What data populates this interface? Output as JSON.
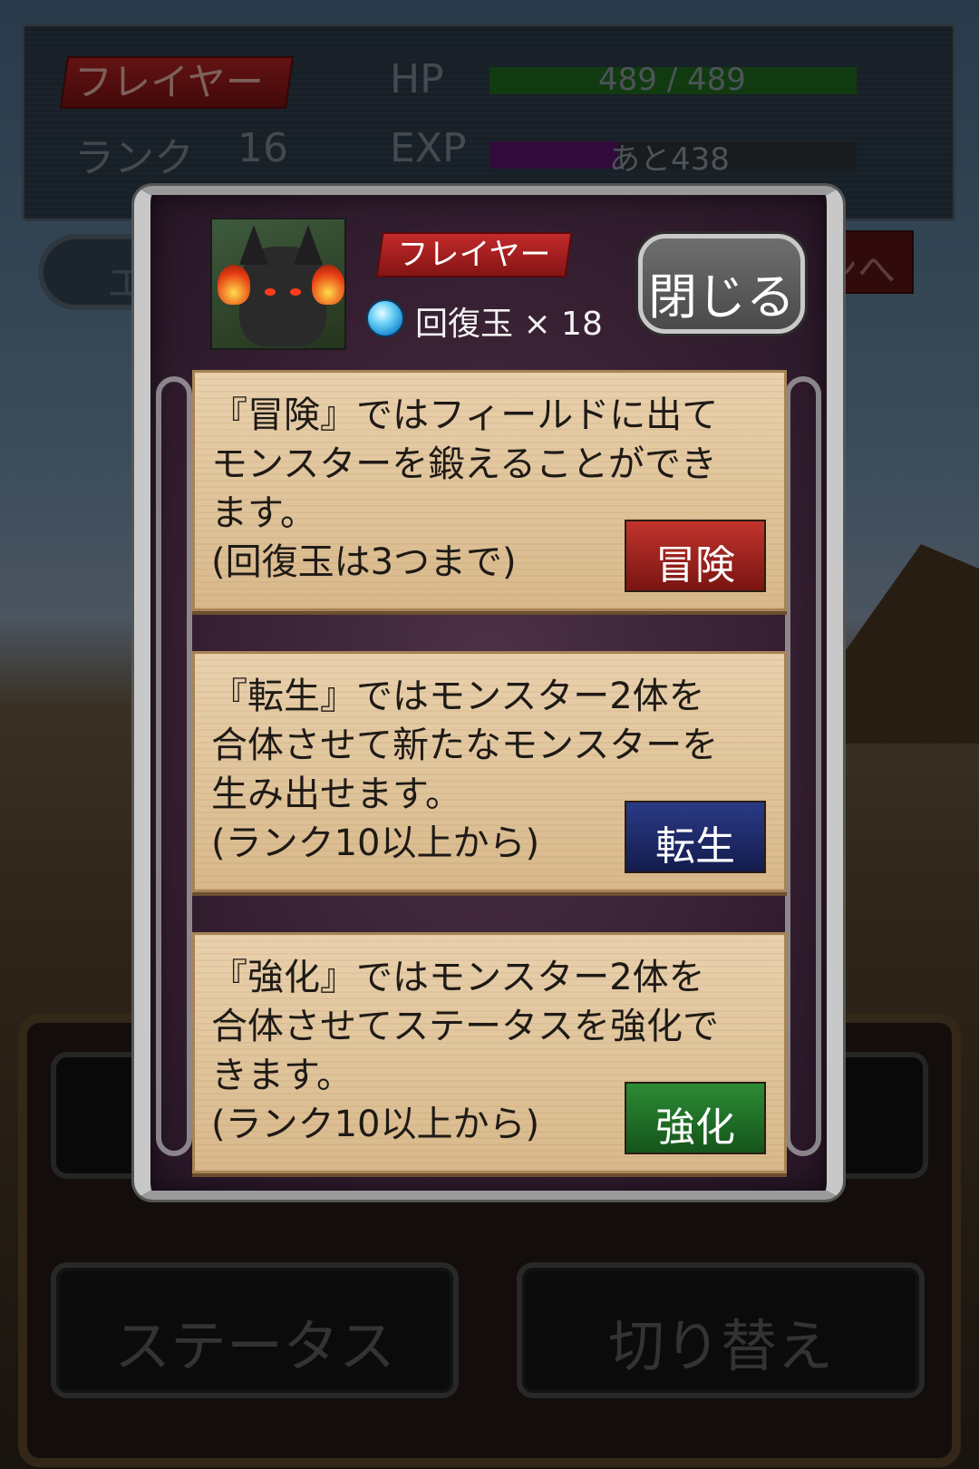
{
  "status": {
    "player_name": "フレイヤー",
    "rank_label": "ランク",
    "rank_value": "16",
    "hp_label": "HP",
    "hp_text": "489 / 489",
    "hp_fraction": 1.0,
    "exp_label": "EXP",
    "exp_text": "あと438",
    "exp_fraction": 0.35
  },
  "background_buttons": {
    "area_label": "エリア",
    "right_button_label": "ンへ"
  },
  "bottom_menu": {
    "status_label": "ステータス",
    "switch_label": "切り替え"
  },
  "dialog": {
    "monster_name": "フレイヤー",
    "item_text": "回復玉 × 18",
    "close_label": "閉じる",
    "cards": [
      {
        "text": "『冒険』ではフィールドに出て\nモンスターを鍛えることができ\nます。\n(回復玉は3つまで)",
        "button_label": "冒険",
        "button_color": "#a82121"
      },
      {
        "text": "『転生』ではモンスター2体を\n合体させて新たなモンスターを\n生み出せます。\n(ランク10以上から)",
        "button_label": "転生",
        "button_color": "#1f2c6c"
      },
      {
        "text": "『強化』ではモンスター2体を\n合体させてステータスを強化で\nきます。\n(ランク10以上から)",
        "button_label": "強化",
        "button_color": "#1e6e26"
      }
    ]
  },
  "icons": {
    "orb": "recovery-orb-icon",
    "portrait": "monster-portrait"
  }
}
